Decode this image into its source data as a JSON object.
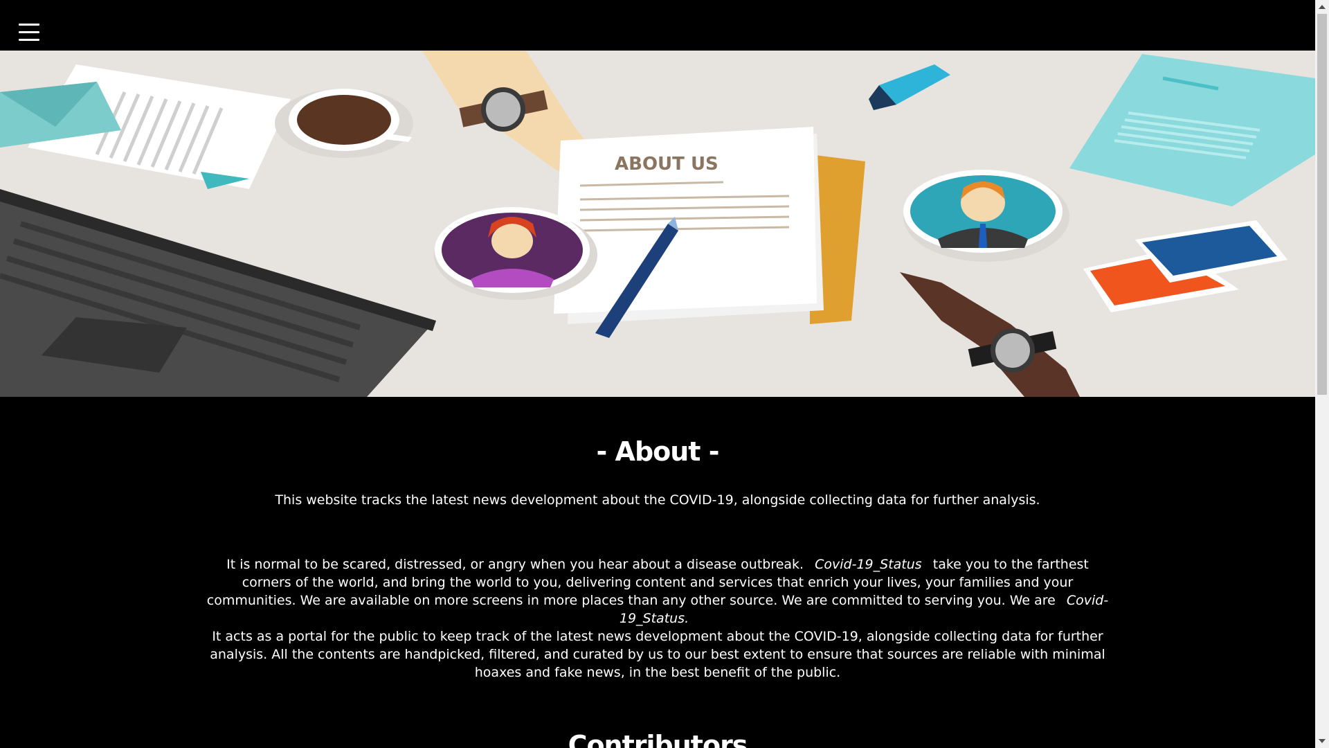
{
  "nav": {
    "menu_icon": "hamburger-menu-icon"
  },
  "hero": {
    "sign_text": "ABOUT US"
  },
  "about": {
    "title": "- About -",
    "intro": "This website tracks the latest news development about the COVID-19, alongside collecting data for further analysis.",
    "p1_before": "It is normal to be scared, distressed, or angry when you hear about a disease outbreak.",
    "p1_brand1": "Covid-19_Status",
    "p1_middle": "take you to the farthest corners of the world, and bring the world to you, delivering content and services that enrich your lives, your families and your communities. We are available on more screens in more places than any other source. We are committed to serving you. We are",
    "p1_brand2": "Covid-19_Status.",
    "p2": "It acts as a portal for the public to keep track of the latest news development about the COVID-19, alongside collecting data for further analysis. All the contents are handpicked, filtered, and curated by us to our best extent to ensure that sources are reliable with minimal hoaxes and fake news, in the best benefit of the public."
  },
  "contributors": {
    "title": "Contributors"
  }
}
